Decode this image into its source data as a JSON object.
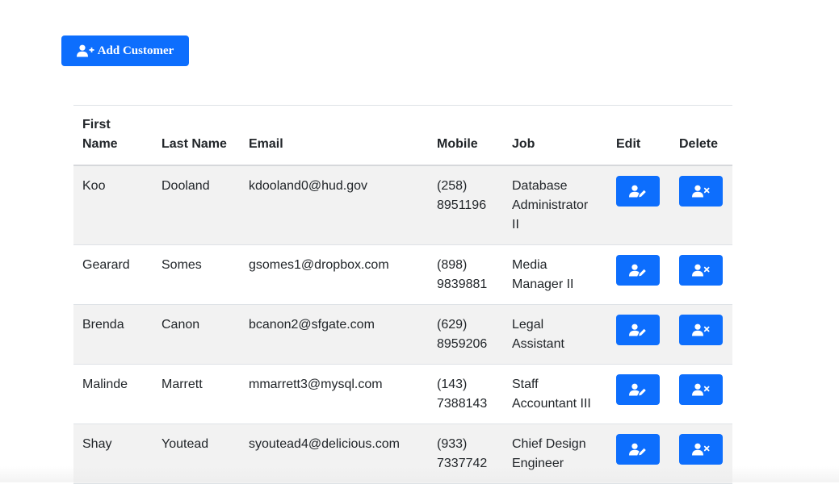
{
  "toolbar": {
    "add_customer_label": "Add Customer",
    "add_customer_icon": "user-plus-icon",
    "accent_color": "#0d6efd"
  },
  "table": {
    "headers": {
      "first_name": "First Name",
      "last_name": "Last Name",
      "email": "Email",
      "mobile": "Mobile",
      "job": "Job",
      "edit": "Edit",
      "delete": "Delete"
    },
    "edit_icon": "user-pen-icon",
    "delete_icon": "user-x-icon",
    "rows": [
      {
        "first_name": "Koo",
        "last_name": "Dooland",
        "email": "kdooland0@hud.gov",
        "mobile": "(258) 8951196",
        "job": "Database Administrator II"
      },
      {
        "first_name": "Gearard",
        "last_name": "Somes",
        "email": "gsomes1@dropbox.com",
        "mobile": "(898) 9839881",
        "job": "Media Manager II"
      },
      {
        "first_name": "Brenda",
        "last_name": "Canon",
        "email": "bcanon2@sfgate.com",
        "mobile": "(629) 8959206",
        "job": "Legal Assistant"
      },
      {
        "first_name": "Malinde",
        "last_name": "Marrett",
        "email": "mmarrett3@mysql.com",
        "mobile": "(143) 7388143",
        "job": "Staff Accountant III"
      },
      {
        "first_name": "Shay",
        "last_name": "Youtead",
        "email": "syoutead4@delicious.com",
        "mobile": "(933) 7337742",
        "job": "Chief Design Engineer"
      }
    ]
  }
}
